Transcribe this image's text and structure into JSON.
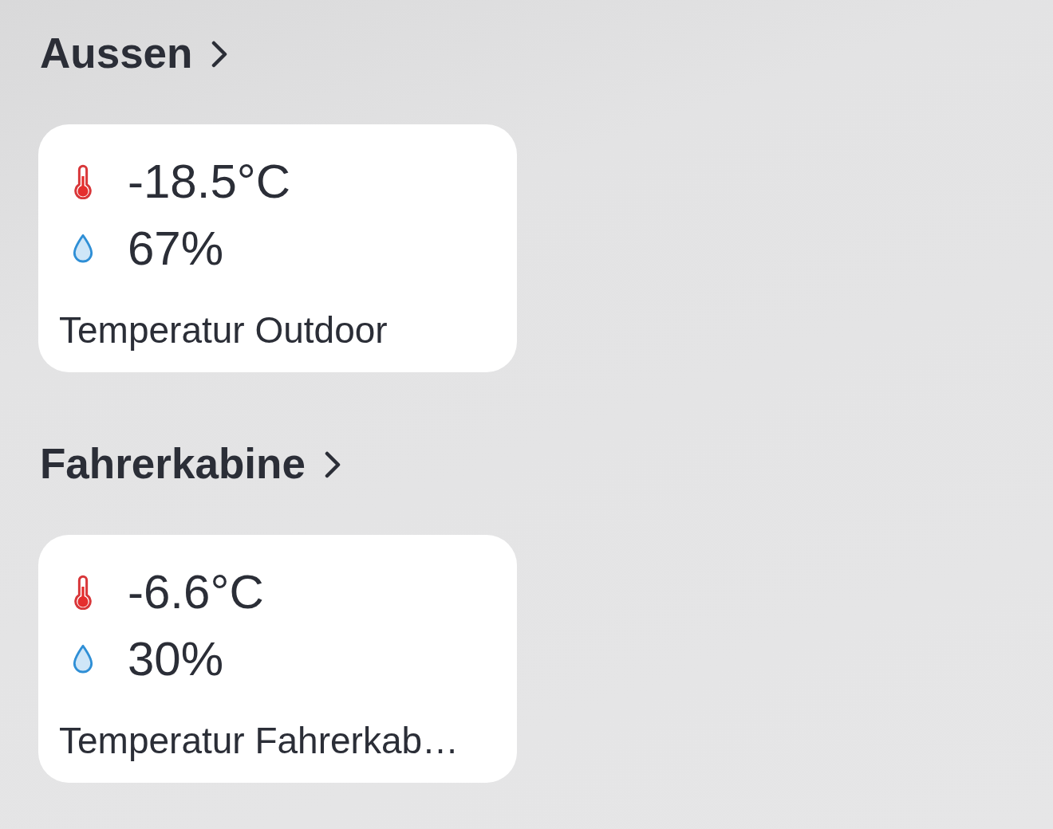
{
  "sections": [
    {
      "title": "Aussen",
      "card": {
        "readings": [
          {
            "kind": "temperature",
            "value": "-18.5°C"
          },
          {
            "kind": "humidity",
            "value": "67%"
          }
        ],
        "name": "Temperatur Outdoor"
      }
    },
    {
      "title": "Fahrerkabine",
      "card": {
        "readings": [
          {
            "kind": "temperature",
            "value": "-6.6°C"
          },
          {
            "kind": "humidity",
            "value": "30%"
          }
        ],
        "name": "Temperatur Fahrerkab…"
      }
    }
  ]
}
